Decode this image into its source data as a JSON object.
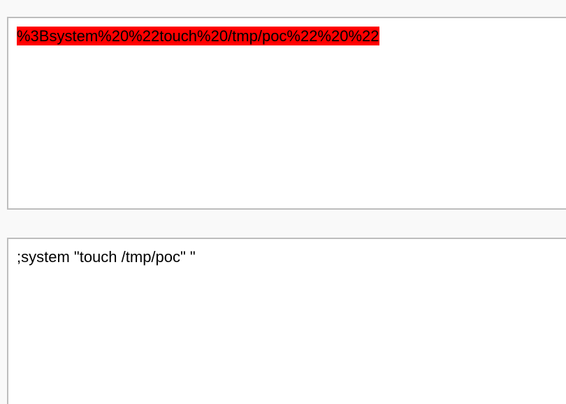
{
  "encoded_input": {
    "value": "%3Bsystem%20%22touch%20/tmp/poc%22%20%22",
    "highlight_color": "#ff0000"
  },
  "decoded_output": {
    "value": ";system \"touch /tmp/poc\" \""
  }
}
